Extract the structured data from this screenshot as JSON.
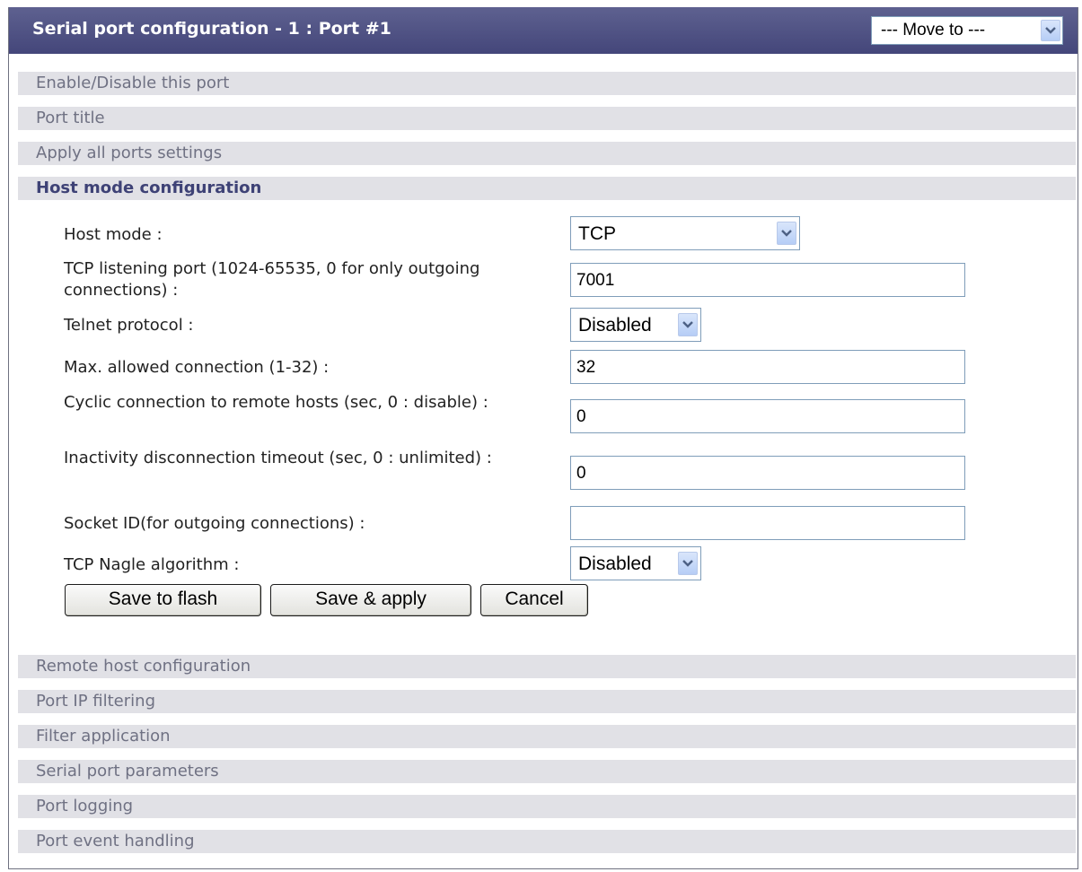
{
  "header": {
    "title": "Serial port configuration - 1 : Port #1",
    "move_to": "--- Move to ---"
  },
  "sections": {
    "enable": "Enable/Disable this port",
    "title": "Port title",
    "apply_all": "Apply all ports settings",
    "host_mode": "Host mode configuration",
    "remote_host": "Remote host configuration",
    "ip_filter": "Port IP filtering",
    "filter_app": "Filter application",
    "serial_params": "Serial port parameters",
    "logging": "Port logging",
    "event": "Port event handling"
  },
  "form": {
    "host_mode": {
      "label": "Host mode :",
      "value": "TCP"
    },
    "tcp_port": {
      "label": "TCP listening port (1024-65535, 0 for only outgoing connections) :",
      "value": "7001"
    },
    "telnet": {
      "label": "Telnet protocol :",
      "value": "Disabled"
    },
    "max_conn": {
      "label": "Max. allowed connection (1-32) :",
      "value": "32"
    },
    "cyclic": {
      "label": "Cyclic connection to remote hosts (sec, 0 : disable) :",
      "value": "0"
    },
    "inactivity": {
      "label": "Inactivity disconnection timeout (sec, 0 : unlimited) :",
      "value": "0"
    },
    "socket_id": {
      "label": "Socket ID(for outgoing connections) :",
      "value": ""
    },
    "nagle": {
      "label": "TCP Nagle algorithm :",
      "value": "Disabled"
    }
  },
  "buttons": {
    "save_flash": "Save to flash",
    "save_apply": "Save & apply",
    "cancel": "Cancel"
  },
  "icons": {
    "dropdown": "chevron-down-icon"
  },
  "colors": {
    "header_bg": "#4b4e80",
    "section_bg": "#e1e1e6",
    "active_section_text": "#3e4276"
  }
}
